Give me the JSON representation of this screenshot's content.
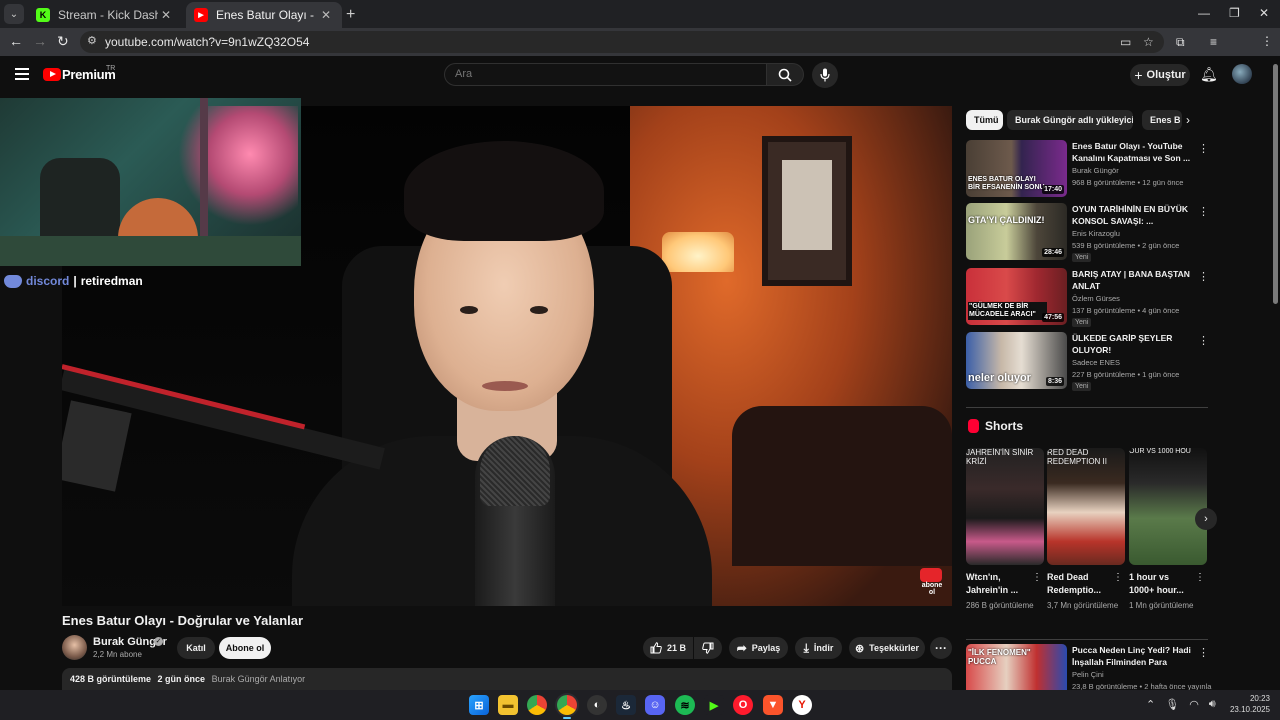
{
  "browser": {
    "tabs": [
      {
        "title": "Stream - Kick Dashboard",
        "favicon": "kick-icon",
        "color": "#53fc18"
      },
      {
        "title": "Enes Batur Olayı - Doğrular ve Yalanlar - YouTube",
        "favicon": "youtube-icon",
        "color": "#ff0000"
      }
    ],
    "url": "youtube.com/watch?v=9n1wZQ32O54"
  },
  "youtube": {
    "brand": "Premium",
    "region": "TR",
    "search_placeholder": "Ara",
    "create_label": "Oluştur"
  },
  "overlay": {
    "discord_word": "discord",
    "discord_sep": "|",
    "discord_name": "retiredman"
  },
  "video": {
    "title": "Enes Batur Olayı - Doğrular ve Yalanlar",
    "channel": "Burak Güngör",
    "subscribers": "2,2 Mn abone",
    "join_label": "Katıl",
    "subscribe_label": "Abone ol",
    "likes": "21 B",
    "share_label": "Paylaş",
    "download_label": "İndir",
    "thanks_label": "Teşekkürler",
    "views": "428 B görüntüleme",
    "age": "2 gün önce",
    "tagline": "Burak Güngör Anlatıyor",
    "corner_badge": "abone ol"
  },
  "chips": [
    "Tümü",
    "Burak Güngör adlı yükleyiciden",
    "Enes B"
  ],
  "recommendations": [
    {
      "title": "Enes Batur Olayı - YouTube Kanalını Kapatması ve Son ...",
      "channel": "Burak Güngör",
      "meta": "968 B görüntüleme • 12 gün önce",
      "duration": "17:40",
      "badge": "",
      "thumb_caption": "ENES BATUR OLAYI BİR EFSANENİN SONU"
    },
    {
      "title": "OYUN TARİHİNİN EN BÜYÜK KONSOL SAVAŞI: ...",
      "channel": "Enis Kirazoglu",
      "meta": "539 B görüntüleme • 2 gün önce",
      "duration": "28:46",
      "badge": "Yeni",
      "thumb_caption": "GTA'YI ÇALDINIZ!"
    },
    {
      "title": "BARIŞ ATAY | BANA BAŞTAN ANLAT",
      "channel": "Özlem Gürses",
      "meta": "137 B görüntüleme • 4 gün önce",
      "duration": "47:56",
      "badge": "Yeni",
      "thumb_caption": "\"GÜLMEK DE BİR MÜCADELE ARACI\""
    },
    {
      "title": "ÜLKEDE GARİP ŞEYLER OLUYOR!",
      "channel": "Sadece ENES",
      "meta": "227 B görüntüleme • 1 gün önce",
      "duration": "8:36",
      "badge": "Yeni",
      "thumb_caption": "neler oluyor"
    }
  ],
  "shorts_header": "Shorts",
  "shorts": [
    {
      "title": "Wtcn'ın, Jahrein'in ...",
      "views": "286 B görüntüleme",
      "caption": "JAHREİN'İN SİNİR KRİZİ"
    },
    {
      "title": "Red Dead Redemptio...",
      "views": "3,7 Mn görüntüleme",
      "caption": "RED DEAD REDEMPTION II"
    },
    {
      "title": "1 hour vs 1000+ hour...",
      "views": "1 Mn görüntüleme",
      "caption": "OUR VS 1000 HOU"
    }
  ],
  "bottom_rec": {
    "title": "Pucca Neden Linç Yedi? Hadi İnşallah Filminden Para Kazan...",
    "channel": "Pelin Çini",
    "meta": "23,8 B görüntüleme • 2 hafta önce yayınla",
    "thumb_caption": "\"İLK FENOMEN\" PUCCA"
  },
  "clock": {
    "time": "20:23",
    "date": "23.10.2025"
  },
  "colors": {
    "accent": "#ff0000",
    "discord": "#7289da",
    "kick": "#53fc18"
  }
}
